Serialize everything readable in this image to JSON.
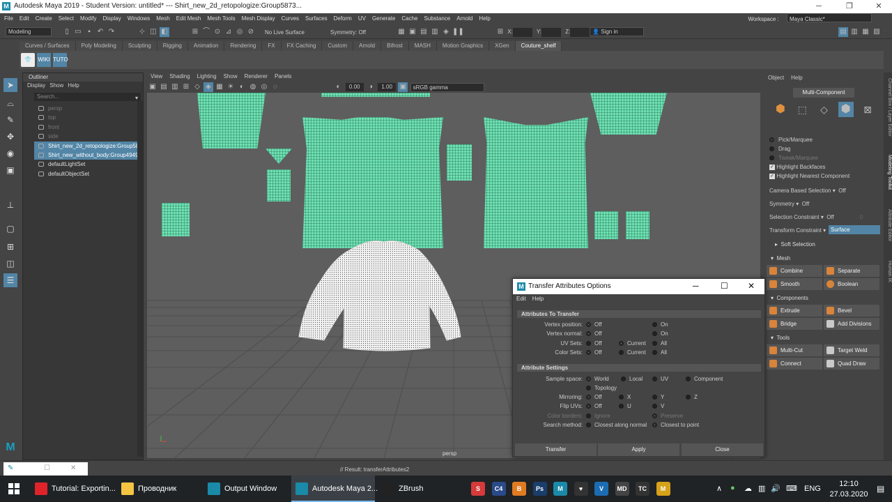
{
  "window": {
    "title": "Autodesk Maya 2019 - Student Version: untitled*   ---   Shirt_new_2d_retopologize:Group5873...",
    "logo_letter": "M"
  },
  "menubar": {
    "items": [
      "File",
      "Edit",
      "Create",
      "Select",
      "Modify",
      "Display",
      "Windows",
      "Mesh",
      "Edit Mesh",
      "Mesh Tools",
      "Mesh Display",
      "Curves",
      "Surfaces",
      "Deform",
      "UV",
      "Generate",
      "Cache",
      "Substance",
      "Arnold",
      "Help"
    ],
    "workspace_label": "Workspace :",
    "workspace_value": "Maya Classic*"
  },
  "statusline": {
    "mode": "Modeling",
    "live_surface": "No Live Surface",
    "symmetry": "Symmetry: Off",
    "x_label": "X:",
    "y_label": "Y:",
    "z_label": "Z:",
    "sign_in": "Sign in"
  },
  "shelf": {
    "tabs": [
      "Curves / Surfaces",
      "Poly Modeling",
      "Sculpting",
      "Rigging",
      "Animation",
      "Rendering",
      "FX",
      "FX Caching",
      "Custom",
      "Arnold",
      "Bifrost",
      "MASH",
      "Motion Graphics",
      "XGen",
      "Couture_shelf"
    ],
    "active_tab": "Couture_shelf",
    "buttons": [
      "WIKI",
      "TUTO"
    ]
  },
  "outliner": {
    "title": "Outliner",
    "menu": [
      "Display",
      "Show",
      "Help"
    ],
    "search_placeholder": "Search...",
    "items": [
      {
        "label": "persp",
        "state": "dim"
      },
      {
        "label": "top",
        "state": "dim"
      },
      {
        "label": "front",
        "state": "dim"
      },
      {
        "label": "side",
        "state": "dim"
      },
      {
        "label": "Shirt_new_2d_retopologize:Group58",
        "state": "selected"
      },
      {
        "label": "Shirt_new_without_body:Group4949",
        "state": "selected"
      },
      {
        "label": "defaultLightSet",
        "state": "normal"
      },
      {
        "label": "defaultObjectSet",
        "state": "normal"
      }
    ]
  },
  "viewport": {
    "menu": [
      "View",
      "Shading",
      "Lighting",
      "Show",
      "Renderer",
      "Panels"
    ],
    "exposure": "0.00",
    "gamma": "1.00",
    "color_space": "sRGB gamma",
    "camera_label": "persp"
  },
  "modeling_toolkit": {
    "menu": [
      "Object",
      "Help"
    ],
    "mode": "Multi-Component",
    "pick_options": [
      {
        "label": "Pick/Marquee",
        "state": "on"
      },
      {
        "label": "Drag",
        "state": "off"
      },
      {
        "label": "Tweak/Marquee",
        "state": "dim"
      }
    ],
    "checks": [
      "Highlight Backfaces",
      "Highlight Nearest Component"
    ],
    "camera_based_selection_label": "Camera Based Selection",
    "camera_based_selection_value": "Off",
    "symmetry_label": "Symmetry",
    "symmetry_value": "Off",
    "selection_constraint_label": "Selection Constraint",
    "selection_constraint_value": "Off",
    "selection_constraint_number": "0",
    "transform_constraint_label": "Transform Constraint",
    "transform_constraint_value": "Surface",
    "soft_selection": "Soft Selection",
    "sections": {
      "mesh": "Mesh",
      "components": "Components",
      "tools": "Tools"
    },
    "mesh_buttons": [
      "Combine",
      "Separate",
      "Smooth",
      "Boolean"
    ],
    "component_buttons": [
      "Extrude",
      "Bevel",
      "Bridge",
      "Add Divisions"
    ],
    "tool_buttons": [
      "Multi-Cut",
      "Target Weld",
      "Connect",
      "Quad Draw"
    ],
    "colors": {
      "mesh_icon": "#d9843b",
      "tool_icon": "#c9c9c9"
    }
  },
  "side_tabs": [
    "Channel Box / Layer Editor",
    "Modeling Toolkit",
    "Attribute Editor",
    "Human IK"
  ],
  "dialog": {
    "title": "Transfer Attributes Options",
    "menu": [
      "Edit",
      "Help"
    ],
    "section1": "Attributes To Transfer",
    "vertex_position": {
      "label": "Vertex position:",
      "options": [
        "Off",
        "On"
      ],
      "selected": "Off"
    },
    "vertex_normal": {
      "label": "Vertex normal:",
      "options": [
        "Off",
        "On"
      ],
      "selected": "Off"
    },
    "uv_sets": {
      "label": "UV Sets:",
      "options": [
        "Off",
        "Current",
        "All"
      ],
      "selected": "Current"
    },
    "color_sets": {
      "label": "Color Sets:",
      "options": [
        "Off",
        "Current",
        "All"
      ],
      "selected": "Off"
    },
    "section2": "Attribute Settings",
    "sample_space": {
      "label": "Sample space:",
      "options": [
        "World",
        "Local",
        "UV",
        "Component",
        "Topology"
      ],
      "selected": "World"
    },
    "mirroring": {
      "label": "Mirroring:",
      "options": [
        "Off",
        "X",
        "Y",
        "Z"
      ],
      "selected": "Off"
    },
    "flip_uvs": {
      "label": "Flip UVs:",
      "options": [
        "Off",
        "U",
        "V"
      ],
      "selected": "Off"
    },
    "color_borders": {
      "label": "Color borders:",
      "options": [
        "Ignore",
        "Preserve"
      ],
      "selected": "Preserve"
    },
    "search_method": {
      "label": "Search method:",
      "options": [
        "Closest along normal",
        "Closest to point"
      ],
      "selected": "Closest to point"
    },
    "buttons": [
      "Transfer",
      "Apply",
      "Close"
    ]
  },
  "command_line": {
    "result": "// Result: transferAttributes2"
  },
  "taskbar": {
    "apps": [
      {
        "label": "Tutorial: Exportin...",
        "color": "#e0232b"
      },
      {
        "label": "Проводник",
        "color": "#f4c542"
      },
      {
        "label": "Output Window",
        "color": "#1a8aa8"
      },
      {
        "label": "Autodesk Maya 2...",
        "color": "#1a8aa8"
      },
      {
        "label": "ZBrush",
        "color": "#222222"
      }
    ],
    "pinned": [
      {
        "label": "S",
        "color": "#d63a3a"
      },
      {
        "label": "C4",
        "color": "#2a4a8a"
      },
      {
        "label": "B",
        "color": "#e07b22"
      },
      {
        "label": "Ps",
        "color": "#1b3d6b"
      },
      {
        "label": "M",
        "color": "#1a8aa8"
      },
      {
        "label": "♥",
        "color": "#333333"
      },
      {
        "label": "V",
        "color": "#1b6db3"
      },
      {
        "label": "MD",
        "color": "#444444"
      },
      {
        "label": "TC",
        "color": "#333333"
      },
      {
        "label": "M",
        "color": "#d6a21a"
      }
    ],
    "language": "ENG",
    "time": "12:10",
    "date": "27.03.2020"
  }
}
